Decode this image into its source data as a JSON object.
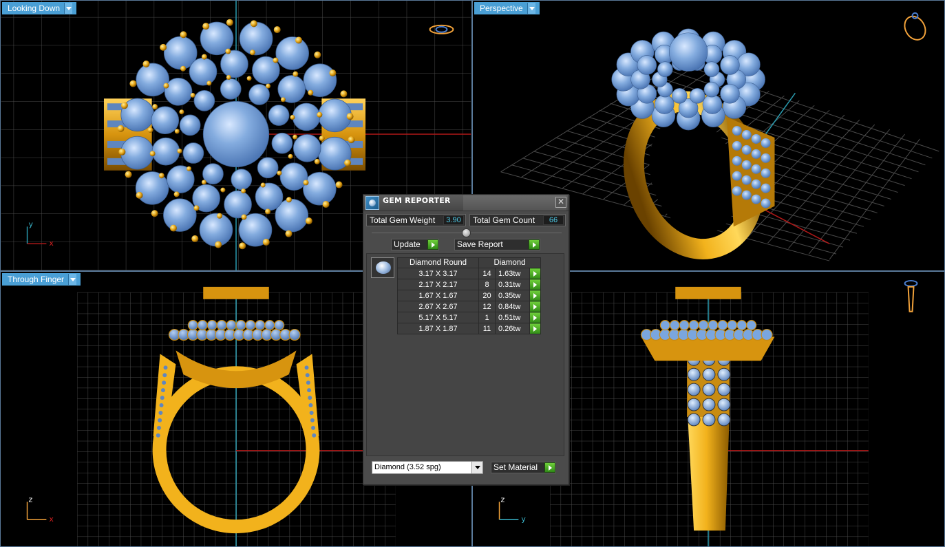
{
  "viewports": {
    "top": {
      "label": "Looking Down",
      "axis_v": "y",
      "axis_h": "x"
    },
    "perspective": {
      "label": "Perspective"
    },
    "front": {
      "label": "Through Finger",
      "axis_v": "z",
      "axis_h": "x"
    },
    "side": {
      "axis_v": "z",
      "axis_h": "y"
    }
  },
  "gem_reporter": {
    "title": "GEM REPORTER",
    "close_symbol": "✕",
    "total_weight_label": "Total Gem Weight",
    "total_weight_value": "3.90",
    "total_count_label": "Total Gem Count",
    "total_count_value": "66",
    "update_label": "Update",
    "save_report_label": "Save Report",
    "table_headers": [
      "Diamond Round",
      "Diamond"
    ],
    "rows": [
      {
        "size": "3.17 X 3.17",
        "qty": "14",
        "ctw": "1.63tw"
      },
      {
        "size": "2.17 X 2.17",
        "qty": "8",
        "ctw": "0.31tw"
      },
      {
        "size": "1.67 X 1.67",
        "qty": "20",
        "ctw": "0.35tw"
      },
      {
        "size": "2.67 X 2.67",
        "qty": "12",
        "ctw": "0.84tw"
      },
      {
        "size": "5.17 X 5.17",
        "qty": "1",
        "ctw": "0.51tw"
      },
      {
        "size": "1.87 X 1.87",
        "qty": "11",
        "ctw": "0.26tw"
      }
    ],
    "material_value": "Diamond    (3.52 spg)",
    "set_material_label": "Set Material"
  },
  "colors": {
    "gold": "#f2b21c",
    "gem_blue": "#7aa6df",
    "grid": "#444444",
    "axis_red": "#b01818",
    "axis_cyan": "#2a9cb0",
    "label_blue": "#4a9fd5"
  }
}
